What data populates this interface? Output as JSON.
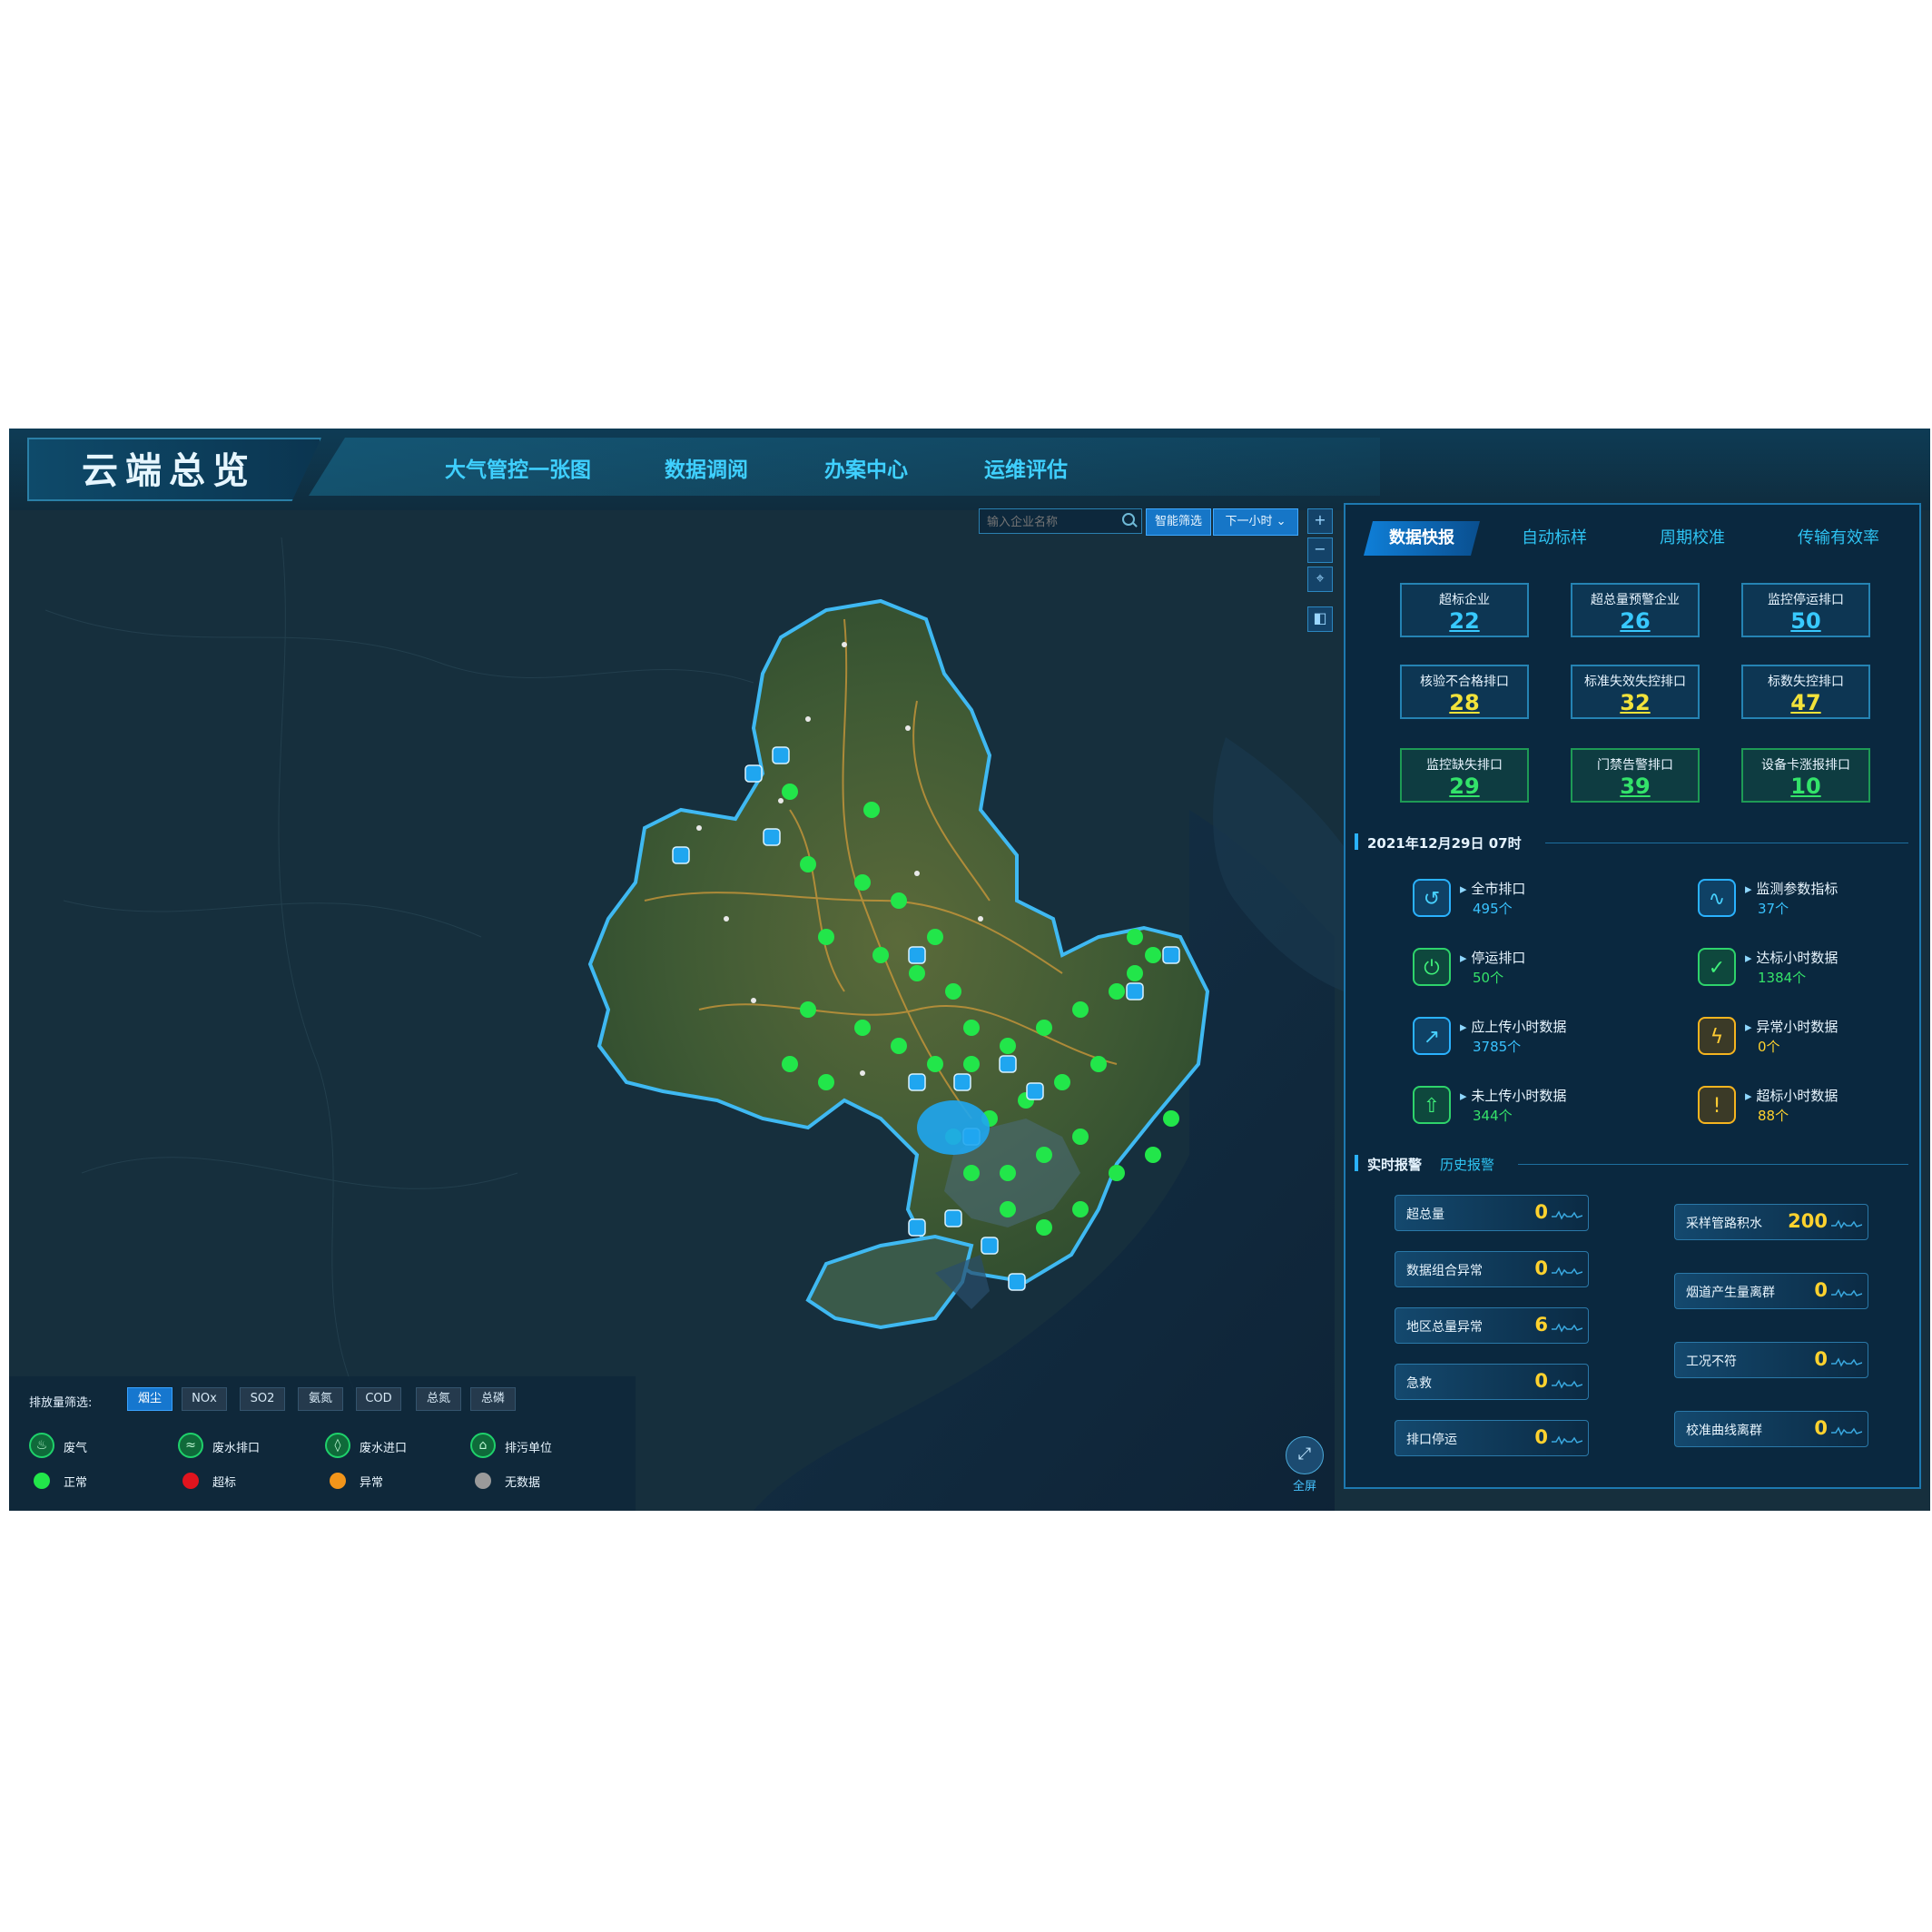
{
  "header": {
    "title": "云端总览",
    "nav": [
      "大气管控一张图",
      "数据调阅",
      "办案中心",
      "运维评估"
    ]
  },
  "map_tools": {
    "search_placeholder": "输入企业名称",
    "smart_button": "智能筛选",
    "time_select": "下一小时",
    "tool_icons": [
      "zoom-in-icon",
      "zoom-out-icon",
      "locate-icon",
      "layer-icon"
    ],
    "fullscreen_label": "全屏"
  },
  "panel": {
    "tabs": [
      "数据快报",
      "自动标样",
      "周期校准",
      "传输有效率"
    ],
    "active_tab": 0,
    "stats": [
      {
        "label": "超标企业",
        "value": "22",
        "color": "#38c9ff"
      },
      {
        "label": "超总量预警企业",
        "value": "26",
        "color": "#38c9ff"
      },
      {
        "label": "监控停运排口",
        "value": "50",
        "color": "#38c9ff"
      },
      {
        "label": "核验不合格排口",
        "value": "28",
        "color": "#f2e23a"
      },
      {
        "label": "标准失效失控排口",
        "value": "32",
        "color": "#f2e23a"
      },
      {
        "label": "标数失控排口",
        "value": "47",
        "color": "#f2e23a"
      },
      {
        "label": "监控缺失排口",
        "value": "29",
        "color": "#33e36a"
      },
      {
        "label": "门禁告警排口",
        "value": "39",
        "color": "#33e36a"
      },
      {
        "label": "设备卡涨报排口",
        "value": "10",
        "color": "#33e36a"
      }
    ],
    "datetime": "2021年12月29日 07时",
    "monitor": [
      {
        "label": "全市排口",
        "value": "495个",
        "icon": "outlet-icon",
        "tone": "blue"
      },
      {
        "label": "监测参数指标",
        "value": "37个",
        "icon": "pulse-icon",
        "tone": "blue"
      },
      {
        "label": "停运排口",
        "value": "50个",
        "icon": "stopped-icon",
        "tone": "green"
      },
      {
        "label": "达标小时数据",
        "value": "1384个",
        "icon": "check-icon",
        "tone": "green"
      },
      {
        "label": "应上传小时数据",
        "value": "3785个",
        "icon": "trend-icon",
        "tone": "blue"
      },
      {
        "label": "异常小时数据",
        "value": "0个",
        "icon": "lightning-icon",
        "tone": "yellow"
      },
      {
        "label": "未上传小时数据",
        "value": "344个",
        "icon": "upload-icon",
        "tone": "green"
      },
      {
        "label": "超标小时数据",
        "value": "88个",
        "icon": "warning-icon",
        "tone": "yellow"
      }
    ],
    "alarm_tabs": [
      "实时报警",
      "历史报警"
    ],
    "alarms_left": [
      {
        "label": "超总量",
        "value": "0"
      },
      {
        "label": "数据组合异常",
        "value": "0"
      },
      {
        "label": "地区总量异常",
        "value": "6"
      },
      {
        "label": "急救",
        "value": "0"
      },
      {
        "label": "排口停运",
        "value": "0"
      }
    ],
    "alarms_right": [
      {
        "label": "采样管路积水",
        "value": "200"
      },
      {
        "label": "烟道产生量离群",
        "value": "0"
      },
      {
        "label": "工况不符",
        "value": "0"
      },
      {
        "label": "校准曲线离群",
        "value": "0"
      }
    ]
  },
  "legend": {
    "title": "排放量筛选:",
    "filters": [
      "烟尘",
      "NOx",
      "SO2",
      "氨氮",
      "COD",
      "总氮",
      "总磷"
    ],
    "active_filter": 0,
    "types": [
      {
        "label": "废气",
        "icon": "gas-icon"
      },
      {
        "label": "废水排口",
        "icon": "water-outlet-icon"
      },
      {
        "label": "废水进口",
        "icon": "water-inlet-icon"
      },
      {
        "label": "排污单位",
        "icon": "factory-icon"
      }
    ],
    "status": [
      {
        "label": "正常",
        "color": "#22e64a"
      },
      {
        "label": "超标",
        "color": "#e0141e"
      },
      {
        "label": "异常",
        "color": "#f2951a"
      },
      {
        "label": "无数据",
        "color": "#9a9a9a"
      }
    ]
  },
  "colors": {
    "accent": "#2ab2ff",
    "marker_green": "#22e64a",
    "marker_blue": "#1fa6f0",
    "region_border": "#3fb9f2"
  }
}
